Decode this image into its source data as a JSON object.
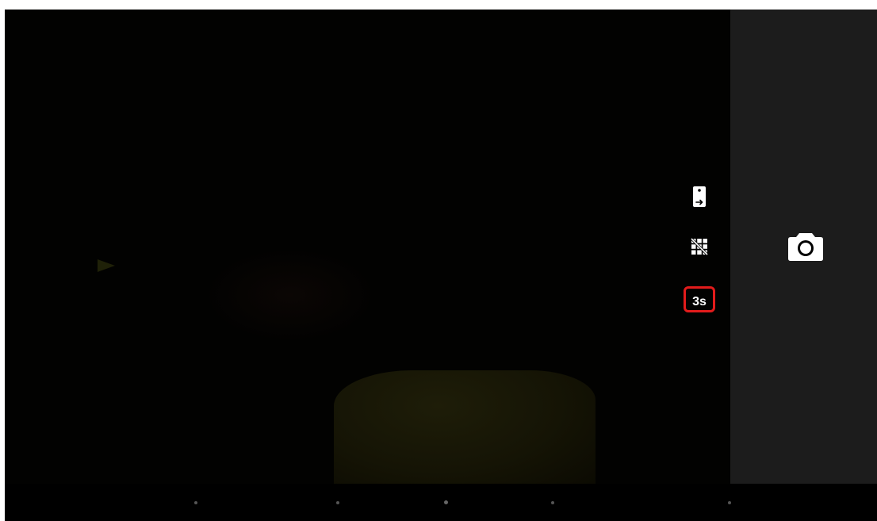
{
  "app": {
    "name": "Camera"
  },
  "controls": {
    "switch_camera_icon": "phone-switch-icon",
    "grid_icon": "grid-off-icon",
    "timer_label": "3s"
  },
  "shutter": {
    "icon": "camera-icon"
  },
  "colors": {
    "viewfinder_bg": "#020201",
    "side_panel_bg": "#1c1c1c",
    "highlight_border": "#e21b1b",
    "icon_color": "#ffffff"
  }
}
